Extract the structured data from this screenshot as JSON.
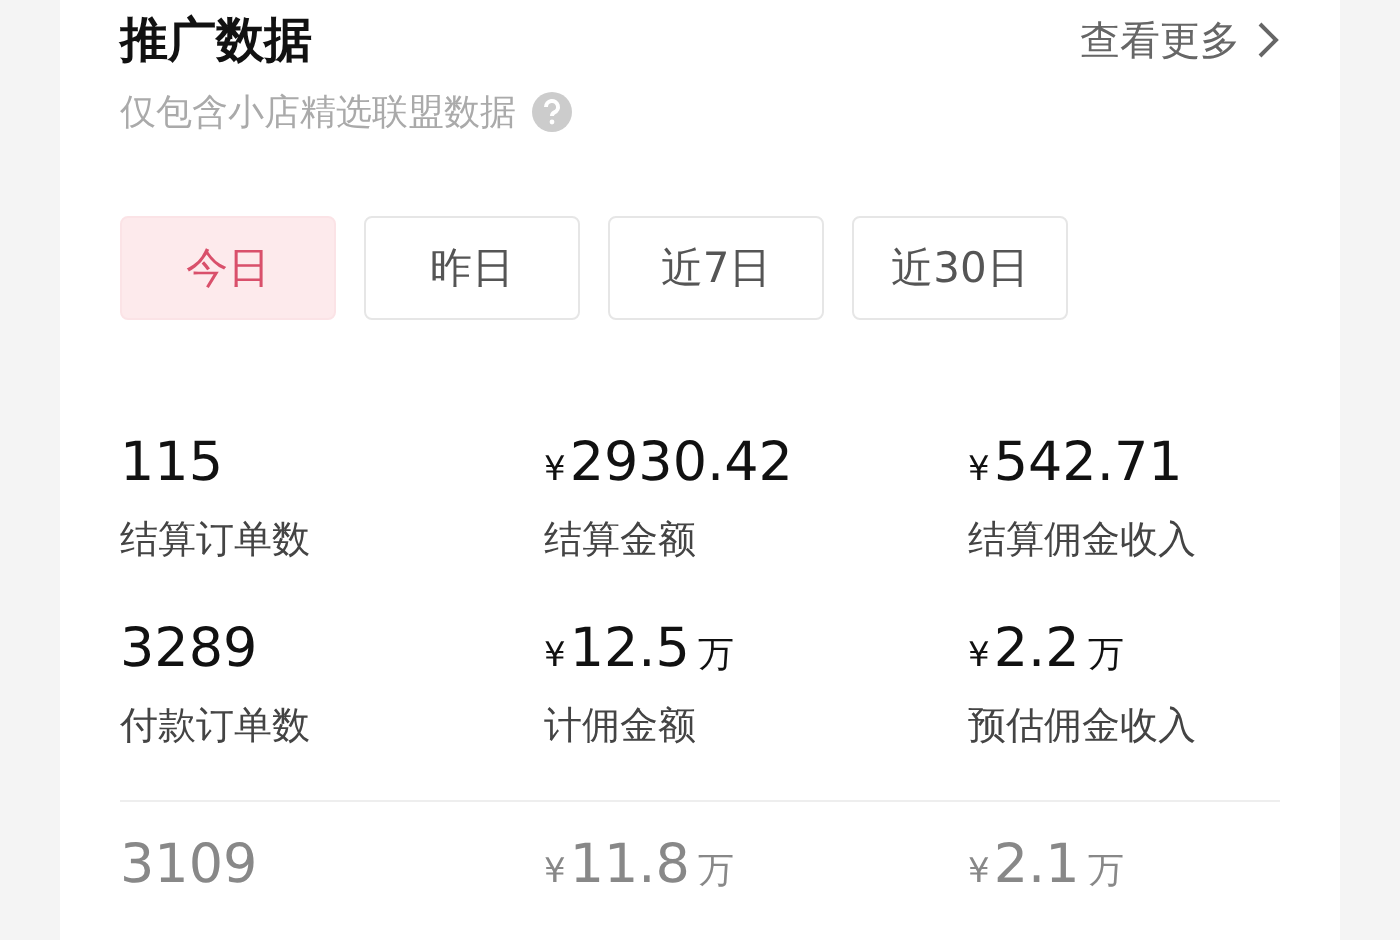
{
  "header": {
    "title": "推广数据",
    "link": "查看更多",
    "subtitle": "仅包含小店精选联盟数据"
  },
  "tabs": [
    {
      "label": "今日",
      "selected": true
    },
    {
      "label": "昨日",
      "selected": false
    },
    {
      "label": "近7日",
      "selected": false
    },
    {
      "label": "近30日",
      "selected": false
    }
  ],
  "groups": [
    {
      "muted": false,
      "rows": [
        [
          {
            "amount": "115",
            "label": "结算订单数"
          },
          {
            "currency": "¥",
            "amount": "2930.42",
            "label": "结算金额"
          },
          {
            "currency": "¥",
            "amount": "542.71",
            "label": "结算佣金收入"
          }
        ],
        [
          {
            "amount": "3289",
            "label": "付款订单数"
          },
          {
            "currency": "¥",
            "amount": "12.5",
            "unit": "万",
            "label": "计佣金额"
          },
          {
            "currency": "¥",
            "amount": "2.2",
            "unit": "万",
            "label": "预估佣金收入"
          }
        ]
      ]
    },
    {
      "muted": true,
      "rows": [
        [
          {
            "amount": "3109"
          },
          {
            "currency": "¥",
            "amount": "11.8",
            "unit": "万"
          },
          {
            "currency": "¥",
            "amount": "2.1",
            "unit": "万"
          }
        ]
      ]
    }
  ]
}
